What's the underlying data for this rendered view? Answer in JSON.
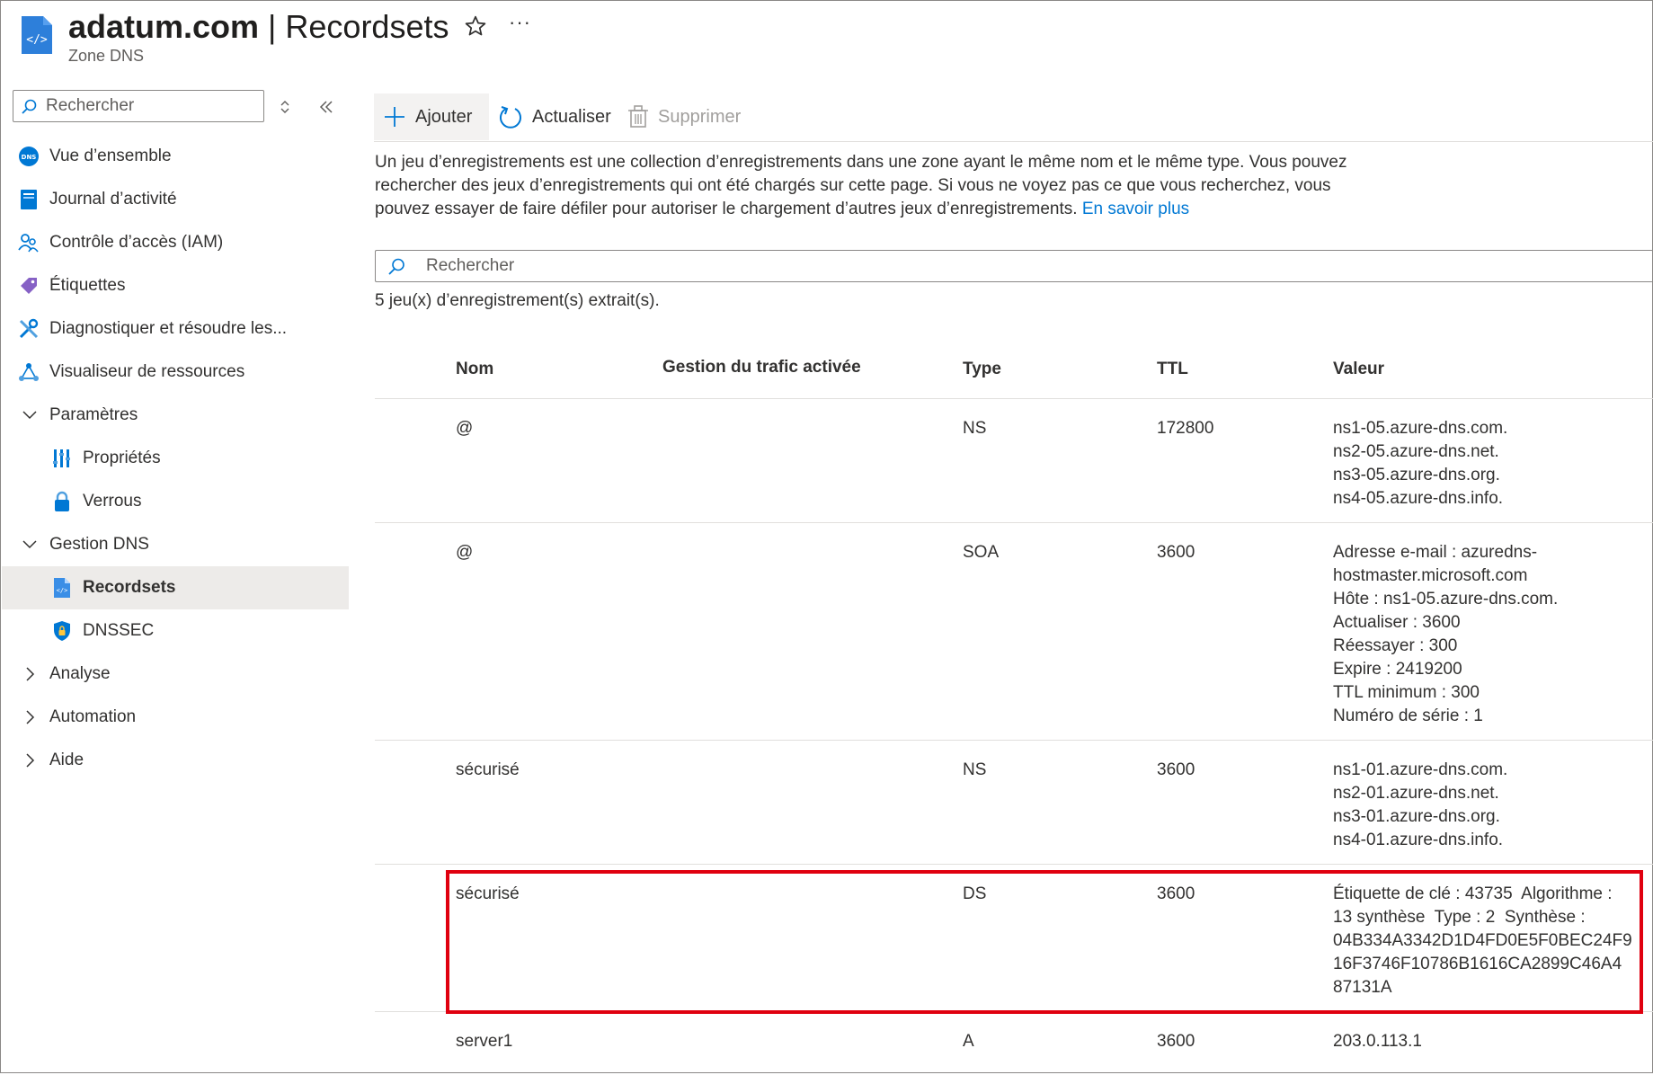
{
  "header": {
    "title_main": "adatum.com",
    "title_sep": " | ",
    "title_page": "Recordsets",
    "subtitle": "Zone DNS"
  },
  "sidebar": {
    "search_placeholder": "Rechercher",
    "items": [
      {
        "label": "Vue d’ensemble",
        "icon": "dns-icon"
      },
      {
        "label": "Journal d’activité",
        "icon": "activity-log-icon"
      },
      {
        "label": "Contrôle d’accès (IAM)",
        "icon": "iam-icon"
      },
      {
        "label": "Étiquettes",
        "icon": "tag-icon"
      },
      {
        "label": "Diagnostiquer et résoudre les...",
        "icon": "wrench-icon"
      },
      {
        "label": "Visualiseur de ressources",
        "icon": "resource-visualizer-icon"
      },
      {
        "label": "Paramètres",
        "icon": "chevron-down-icon"
      },
      {
        "label": "Propriétés",
        "icon": "properties-icon"
      },
      {
        "label": "Verrous",
        "icon": "lock-icon"
      },
      {
        "label": "Gestion DNS",
        "icon": "chevron-down-icon"
      },
      {
        "label": "Recordsets",
        "icon": "recordset-icon"
      },
      {
        "label": "DNSSEC",
        "icon": "shield-icon"
      },
      {
        "label": "Analyse",
        "icon": "chevron-right-icon"
      },
      {
        "label": "Automation",
        "icon": "chevron-right-icon"
      },
      {
        "label": "Aide",
        "icon": "chevron-right-icon"
      }
    ]
  },
  "toolbar": {
    "add_label": "Ajouter",
    "refresh_label": "Actualiser",
    "delete_label": "Supprimer"
  },
  "main": {
    "description": "Un jeu d’enregistrements est une collection d’enregistrements dans une zone ayant le même nom et le même type. Vous pouvez rechercher des jeux d’enregistrements qui ont été chargés sur cette page. Si vous ne voyez pas ce que vous recherchez, vous pouvez essayer de faire défiler pour autoriser le chargement d’autres jeux d’enregistrements.",
    "learn_more": "En savoir plus",
    "search_placeholder": "Rechercher",
    "count_text": "5 jeu(x) d’enregistrement(s) extrait(s)."
  },
  "table": {
    "columns": [
      "Nom",
      "Gestion du trafic activée",
      "Type",
      "TTL",
      "Valeur"
    ],
    "rows": [
      {
        "name": "@",
        "traffic": "",
        "type": "NS",
        "ttl": "172800",
        "value": [
          "ns1-05.azure-dns.com.",
          "ns2-05.azure-dns.net.",
          "ns3-05.azure-dns.org.",
          "ns4-05.azure-dns.info."
        ]
      },
      {
        "name": "@",
        "traffic": "",
        "type": "SOA",
        "ttl": "3600",
        "value": [
          "Adresse e-mail : azuredns-",
          "hostmaster.microsoft.com",
          "Hôte : ns1-05.azure-dns.com.",
          "Actualiser : 3600",
          "Réessayer : 300",
          "Expire : 2419200",
          "TTL minimum : 300",
          "Numéro de série : 1"
        ]
      },
      {
        "name": "sécurisé",
        "traffic": "",
        "type": "NS",
        "ttl": "3600",
        "value": [
          "ns1-01.azure-dns.com.",
          "ns2-01.azure-dns.net.",
          "ns3-01.azure-dns.org.",
          "ns4-01.azure-dns.info."
        ]
      },
      {
        "name": "sécurisé",
        "traffic": "",
        "type": "DS",
        "ttl": "3600",
        "value": [
          "Étiquette de clé : 43735  Algorithme :",
          "13 synthèse  Type : 2  Synthèse :",
          "04B334A3342D1D4FD0E5F0BEC24F9",
          "16F3746F10786B1616CA2899C46A4",
          "87131A"
        ]
      },
      {
        "name": "server1",
        "traffic": "",
        "type": "A",
        "ttl": "3600",
        "value": [
          "203.0.113.1"
        ]
      }
    ]
  }
}
